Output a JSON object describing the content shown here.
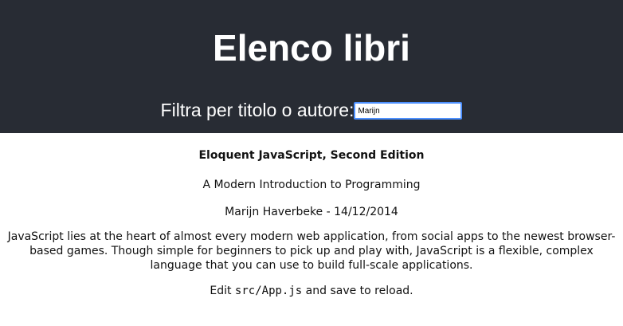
{
  "header": {
    "title": "Elenco libri",
    "filter_label": "Filtra per titolo o autore:",
    "filter_value": "Marijn"
  },
  "book": {
    "title": "Eloquent JavaScript, Second Edition",
    "subtitle": "A Modern Introduction to Programming",
    "author": "Marijn Haverbeke",
    "separator": " - ",
    "date": "14/12/2014",
    "description": "JavaScript lies at the heart of almost every modern web application, from social apps to the newest browser-based games. Though simple for beginners to pick up and play with, JavaScript is a flexible, complex language that you can use to build full-scale applications."
  },
  "footer_note": {
    "prefix": "Edit ",
    "code": "src/App.js",
    "suffix": " and save to reload."
  },
  "colors": {
    "header_background": "#282c34",
    "header_text": "#ffffff",
    "input_focus_border": "#4d90fe",
    "body_text": "#111111"
  }
}
